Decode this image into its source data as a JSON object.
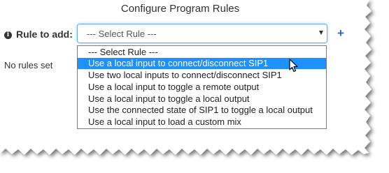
{
  "dialog": {
    "title": "Configure Program Rules"
  },
  "form": {
    "rule_label": "Rule to add:",
    "select_value": "--- Select Rule ---",
    "info_icon_glyph": "i",
    "add_icon_glyph": "+",
    "empty_state": "No rules set"
  },
  "dropdown": {
    "options": [
      "--- Select Rule ---",
      "Use a local input to connect/disconnect SIP1",
      "Use two local inputs to connect/disconnect SIP1",
      "Use a local input to toggle a remote output",
      "Use a local input to toggle a local output",
      "Use the connected state of SIP1 to toggle a local output",
      "Use a local input to load a custom mix"
    ],
    "highlighted_index": 1
  },
  "colors": {
    "accent": "#1e90ff",
    "add_icon": "#2a6ebb",
    "focus_border": "#66afe9"
  },
  "icons": {
    "info": "info-circle-icon",
    "add": "plus-icon",
    "caret": "caret-down-icon",
    "pointer": "mouse-pointer-icon"
  }
}
